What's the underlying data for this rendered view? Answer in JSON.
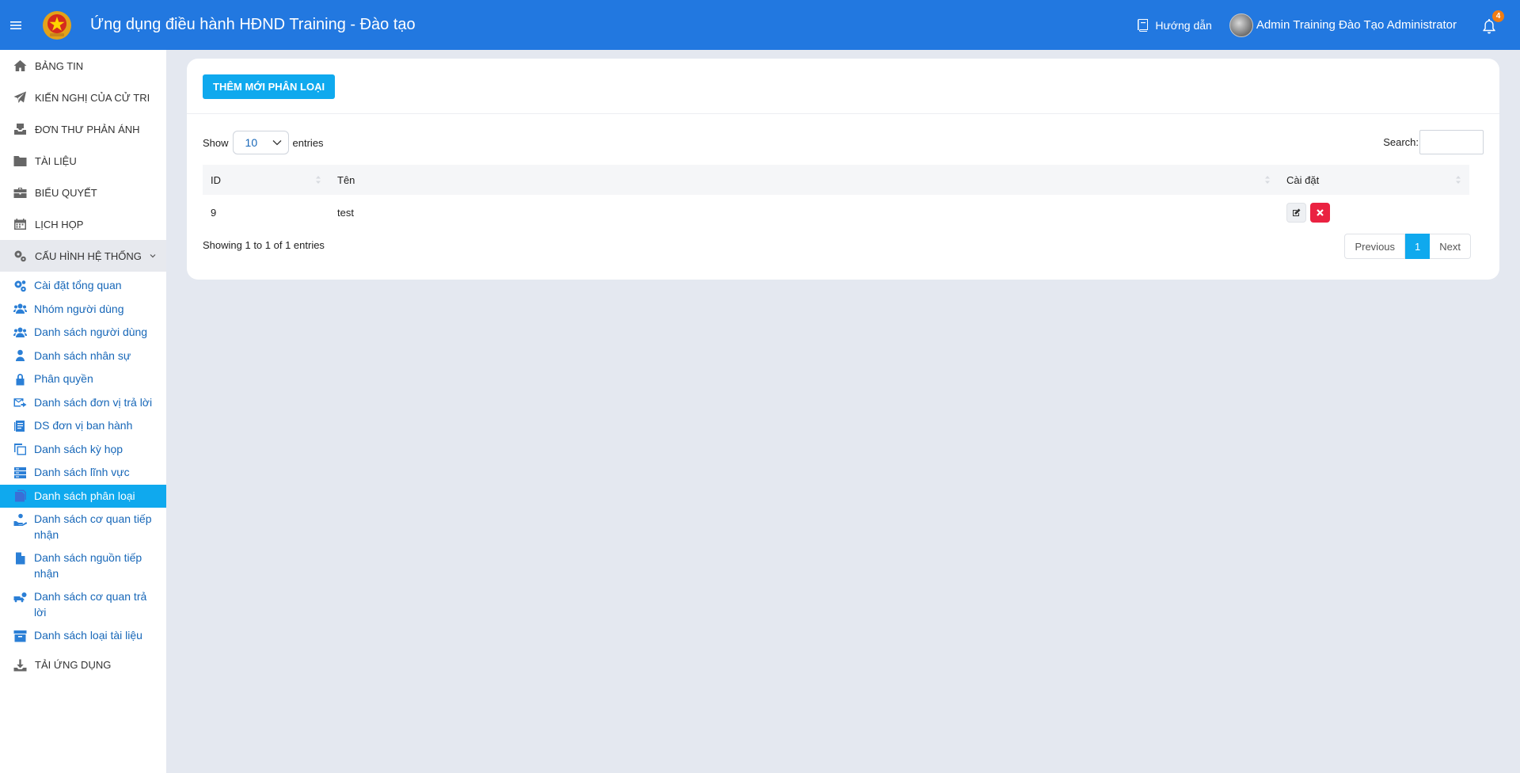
{
  "header": {
    "title": "Ứng dụng điều hành HĐND Training - Đào tạo",
    "guide_label": "Hướng dẫn",
    "user_name": "Admin Training Đào Tạo Administrator",
    "notification_count": "4"
  },
  "sidebar": {
    "items": [
      {
        "label": "BẢNG TIN",
        "icon": "home-icon"
      },
      {
        "label": "KIẾN NGHỊ CỦA CỬ TRI",
        "icon": "paper-plane-icon"
      },
      {
        "label": "ĐƠN THƯ PHẢN ÁNH",
        "icon": "inbox-icon"
      },
      {
        "label": "TÀI LIỆU",
        "icon": "folder-icon"
      },
      {
        "label": "BIỂU QUYẾT",
        "icon": "briefcase-icon"
      },
      {
        "label": "LỊCH HỌP",
        "icon": "calendar-icon"
      }
    ],
    "group_label": "CẤU HÌNH HỆ THỐNG",
    "sub_items": [
      {
        "label": "Cài đặt tổng quan",
        "icon": "cogs-icon"
      },
      {
        "label": "Nhóm người dùng",
        "icon": "users-icon"
      },
      {
        "label": "Danh sách người dùng",
        "icon": "users-icon"
      },
      {
        "label": "Danh sách nhân sự",
        "icon": "user-icon"
      },
      {
        "label": "Phân quyền",
        "icon": "lock-icon"
      },
      {
        "label": "Danh sách đơn vị trả lời",
        "icon": "mail-forward-icon"
      },
      {
        "label": "DS đơn vị ban hành",
        "icon": "document-list-icon"
      },
      {
        "label": "Danh sách kỳ họp",
        "icon": "copy-icon"
      },
      {
        "label": "Danh sách lĩnh vực",
        "icon": "server-icon"
      },
      {
        "label": "Danh sách phân loại",
        "icon": "files-icon"
      },
      {
        "label": "Danh sách cơ quan tiếp nhận",
        "icon": "hand-receive-icon"
      },
      {
        "label": "Danh sách nguồn tiếp nhận",
        "icon": "file-icon"
      },
      {
        "label": "Danh sách cơ quan trả lời",
        "icon": "truck-reply-icon"
      },
      {
        "label": "Danh sách loại tài liệu",
        "icon": "archive-icon"
      }
    ],
    "active_sub": "Danh sách phân loại",
    "last_label": "TẢI ỨNG DỤNG"
  },
  "main": {
    "add_button": "THÊM MỚI PHÂN LOẠI",
    "show_label": "Show",
    "entries_label": "entries",
    "page_length": "10",
    "search_label": "Search:",
    "search_value": "",
    "columns": [
      "ID",
      "Tên",
      "Cài đặt"
    ],
    "rows": [
      {
        "id": "9",
        "name": "test"
      }
    ],
    "info": "Showing 1 to 1 of 1 entries",
    "pagination": {
      "previous": "Previous",
      "current": "1",
      "next": "Next"
    }
  },
  "colors": {
    "header_bg": "#2278e0",
    "accent": "#0fa9ee",
    "danger": "#ea2241",
    "link": "#1767b8",
    "badge": "#f07c12"
  }
}
